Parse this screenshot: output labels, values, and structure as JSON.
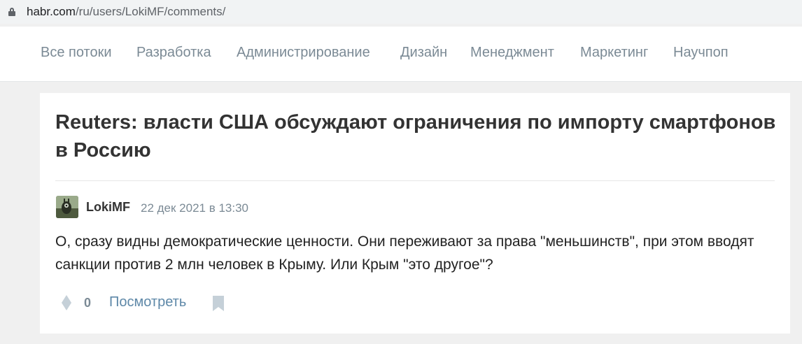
{
  "browser": {
    "url_host": "habr.com",
    "url_path": "/ru/users/LokiMF/comments/"
  },
  "nav": {
    "items": [
      "Все потоки",
      "Разработка",
      "Администрирование",
      "Дизайн",
      "Менеджмент",
      "Маркетинг",
      "Научпоп"
    ]
  },
  "article": {
    "title": "Reuters: власти США обсуждают ограничения по импорту смартфонов в Россию"
  },
  "comment": {
    "author": "LokiMF",
    "date": "22 дек 2021 в 13:30",
    "text": "О, сразу видны демократические ценности. Они переживают за права \"меньшинств\", при этом вводят санкции против 2 млн человек в Крыму. Или Крым \"это другое\"?",
    "votes": "0",
    "view_link": "Посмотреть"
  },
  "colors": {
    "nav_text": "#7b8a95",
    "link": "#5e88a8",
    "icon": "#c5d0d8",
    "page_bg": "#f0f0f0"
  },
  "icons": {
    "lock": "lock-icon",
    "vote": "vote-diamond-icon",
    "bookmark": "bookmark-icon"
  }
}
